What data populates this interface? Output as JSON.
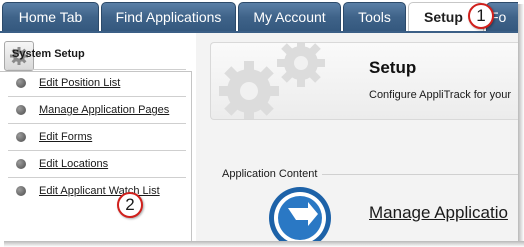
{
  "tabs": [
    {
      "label": "Home Tab"
    },
    {
      "label": "Find Applications"
    },
    {
      "label": "My Account"
    },
    {
      "label": "Tools"
    },
    {
      "label": "Setup"
    },
    {
      "label": "Fo"
    }
  ],
  "callouts": {
    "one": "1",
    "two": "2"
  },
  "sidebar": {
    "title": "System Setup",
    "icon": "gear-icon",
    "items": [
      {
        "label": "Edit Position List"
      },
      {
        "label": "Manage Application Pages"
      },
      {
        "label": "Edit Forms"
      },
      {
        "label": "Edit Locations"
      },
      {
        "label": "Edit Applicant Watch List"
      }
    ]
  },
  "header": {
    "title": "Setup",
    "subtitle": "Configure AppliTrack for your"
  },
  "content": {
    "section_label": "Application Content",
    "manage_link": "Manage Applicatio"
  },
  "colors": {
    "tab_blue": "#3f6389",
    "callout_red": "#d0201c",
    "icon_blue": "#1d62a8"
  }
}
